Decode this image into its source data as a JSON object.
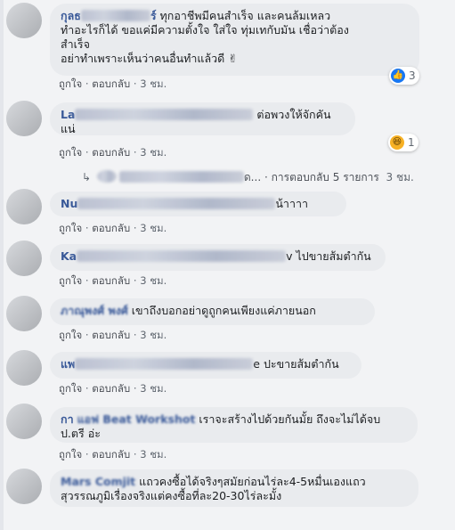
{
  "comments": [
    {
      "name_visible": "กุลธ",
      "name_tail": "ร์",
      "lines": [
        " ทุกอาชีพมีคนสำเร็จ และคนล้มเหลว",
        "ทำอะไรก็ได้ ขอแค่มีความตั้งใจ ใส่ใจ ทุ่มเทกับมัน เชื่อว่าต้อง",
        "สำเร็จ",
        "อย่าทำเพราะเห็นว่าคนอื่นทำแล้วดี ✌"
      ],
      "like_label": "ถูกใจ",
      "reply_label": "ตอบกลับ",
      "time": "3 ชม.",
      "reaction_count": "3"
    },
    {
      "name_visible": "La",
      "lines": [
        " ต่อพวงให้จักคัน",
        "แน่"
      ],
      "like_label": "ถูกใจ",
      "reply_label": "ตอบกลับ",
      "time": "3 ชม.",
      "reaction_count": "1"
    },
    {
      "name_visible": "Nu",
      "lines": [
        "น้าาาา"
      ],
      "like_label": "ถูกใจ",
      "reply_label": "ตอบกลับ",
      "time": "3 ชม."
    },
    {
      "name_visible": "Ka",
      "lines": [
        "v ไปขายส้มตำกัน"
      ],
      "like_label": "ถูกใจ",
      "reply_label": "ตอบกลับ",
      "time": "3 ชม."
    },
    {
      "name_visible": "ภาณุพงศ์ พงศ์",
      "lines": [
        " เขาถึงบอกอย่าดูถูกคนเพียงแค่ภายนอก"
      ],
      "like_label": "ถูกใจ",
      "reply_label": "ตอบกลับ",
      "time": "3 ชม."
    },
    {
      "name_visible": "แพ",
      "lines": [
        "e ปะขายส้มตำกัน"
      ],
      "like_label": "ถูกใจ",
      "reply_label": "ตอบกลับ",
      "time": "3 ชม."
    },
    {
      "name_visible": "กา",
      "name_blur": "แอฟ Beat Workshot",
      "lines": [
        " เราจะสร้างไปด้วยกันมั้ย ถึงจะไม่ได้จบ",
        "ป.ตรี อ่ะ"
      ],
      "like_label": "ถูกใจ",
      "reply_label": "ตอบกลับ",
      "time": "3 ชม."
    },
    {
      "name_visible": "Mars Comjit",
      "lines": [
        " แถวคงซื้อได้จริงๆสมัยก่อนไร่ละ4-5หมื่นเองแถว",
        "สุวรรณภูมิเรื่องจริงแต่คงซื้อที่ละ20-30ไร่ละมั้ง"
      ]
    }
  ],
  "replies": {
    "name_tail": "ด...",
    "separator": "·",
    "label": "การตอบกลับ 5 รายการ",
    "time": "3 ชม."
  },
  "colors": {
    "bubble": "#e9ebee",
    "name": "#385898",
    "like_reaction": "#1877f2",
    "haha_reaction": "#f7b125"
  }
}
